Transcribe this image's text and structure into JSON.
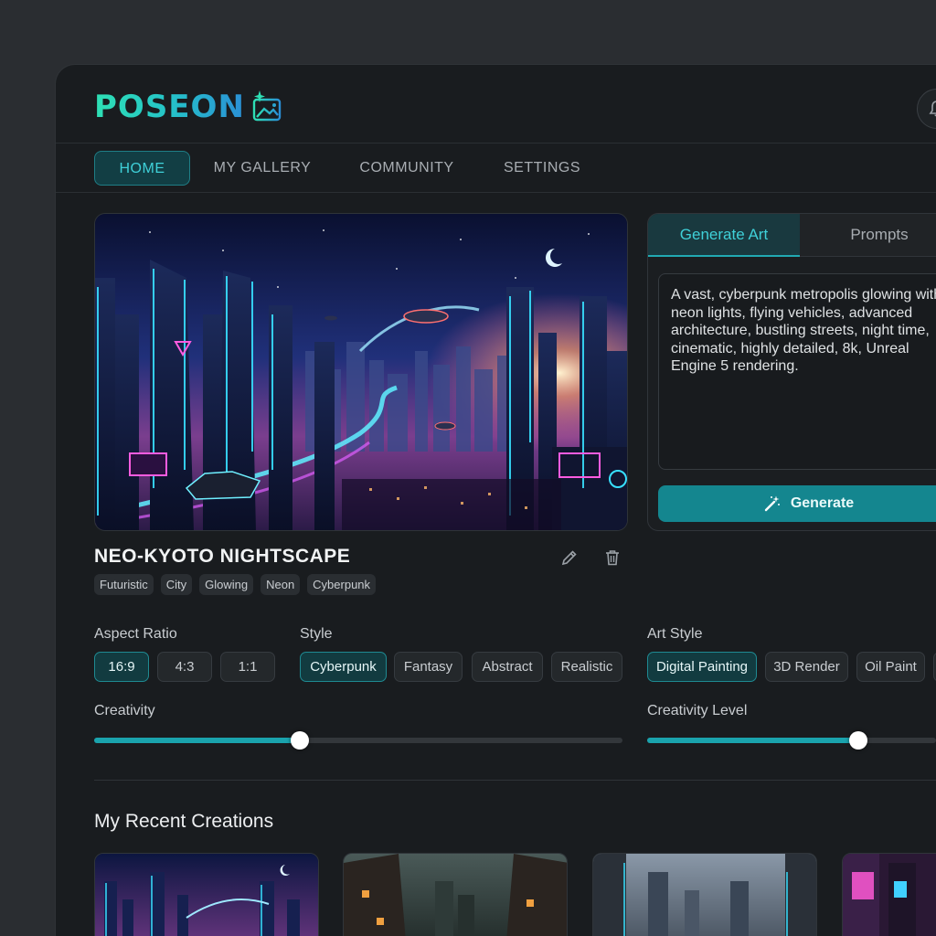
{
  "app": {
    "logo": "POSEON"
  },
  "nav": [
    {
      "label": "HOME",
      "active": true
    },
    {
      "label": "MY GALLERY",
      "active": false
    },
    {
      "label": "COMMUNITY",
      "active": false
    },
    {
      "label": "SETTINGS",
      "active": false
    }
  ],
  "artwork": {
    "title": "NEO-KYOTO NIGHTSCAPE",
    "tags": [
      "Futuristic",
      "City",
      "Glowing",
      "Neon",
      "Cyberpunk"
    ]
  },
  "panel": {
    "tabs": [
      "Generate Art",
      "Prompts"
    ],
    "active_tab": "Generate Art",
    "prompt": "A vast, cyberpunk metropolis glowing with neon lights, flying vehicles, advanced architecture, bustling streets, night time, cinematic, highly detailed, 8k, Unreal Engine 5 rendering.",
    "generate_label": "Generate"
  },
  "controls": {
    "aspect_ratio": {
      "label": "Aspect Ratio",
      "options": [
        "16:9",
        "4:3",
        "1:1"
      ],
      "selected": "16:9"
    },
    "style": {
      "label": "Style",
      "options": [
        "Cyberpunk",
        "Fantasy",
        "Abstract",
        "Realistic"
      ],
      "selected": "Cyberpunk"
    },
    "art_style": {
      "label": "Art Style",
      "options": [
        "Digital Painting",
        "3D Render",
        "Oil Paint"
      ],
      "selected": "Digital Painting"
    },
    "creativity": {
      "label": "Creativity",
      "value": 0.39
    },
    "creativity_level": {
      "label": "Creativity Level",
      "value": 0.73
    }
  },
  "recent": {
    "title": "My Recent Creations"
  },
  "colors": {
    "accent": "#1aa3ad",
    "accent_text": "#3fd0d8",
    "background": "#191c1f"
  }
}
